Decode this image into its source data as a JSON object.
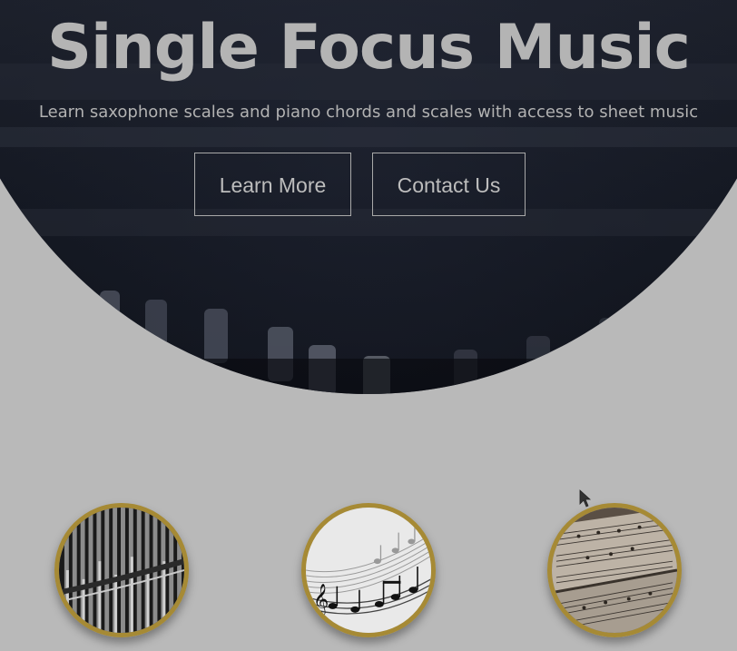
{
  "hero": {
    "title": "Single Focus Music",
    "subtitle": "Learn saxophone scales and piano chords and scales with access to sheet music",
    "buttons": [
      {
        "label": "Learn More"
      },
      {
        "label": "Contact Us"
      }
    ]
  },
  "features": [
    {
      "icon": "organ-pipes-image"
    },
    {
      "icon": "music-notes-image"
    },
    {
      "icon": "sheet-music-image"
    }
  ],
  "colors": {
    "background": "#b9b9b9",
    "hero_dark": "#1d212c",
    "circle_border": "#a68a35",
    "text_light": "#b4b4b4"
  }
}
